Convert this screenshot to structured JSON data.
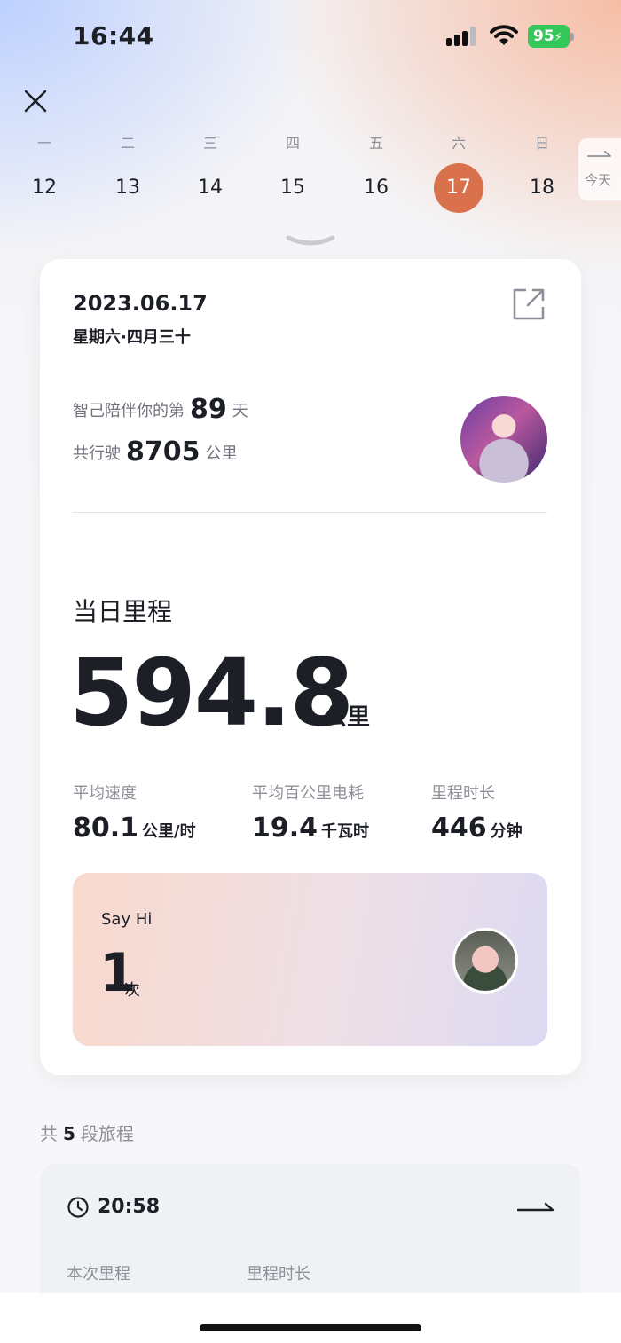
{
  "status_bar": {
    "time": "16:44",
    "battery": "95"
  },
  "calendar": {
    "days": [
      {
        "weekday": "一",
        "date": "12"
      },
      {
        "weekday": "二",
        "date": "13"
      },
      {
        "weekday": "三",
        "date": "14"
      },
      {
        "weekday": "四",
        "date": "15"
      },
      {
        "weekday": "五",
        "date": "16"
      },
      {
        "weekday": "六",
        "date": "17"
      },
      {
        "weekday": "日",
        "date": "18"
      }
    ],
    "selected": "17",
    "today_label": "今天"
  },
  "summary": {
    "date": "2023.06.17",
    "lunar": "星期六·四月三十",
    "companion_prefix": "智己陪伴你的第",
    "companion_days": "89",
    "companion_suffix": "天",
    "total_prefix": "共行驶",
    "total_km": "8705",
    "total_unit": "公里",
    "daily_title": "当日里程",
    "daily_value": "594.8",
    "daily_unit": "公里",
    "metrics": [
      {
        "label": "平均速度",
        "value": "80.1",
        "unit": "公里/时"
      },
      {
        "label": "平均百公里电耗",
        "value": "19.4",
        "unit": "千瓦时"
      },
      {
        "label": "里程时长",
        "value": "446",
        "unit": "分钟"
      }
    ],
    "sayhi": {
      "title": "Say Hi",
      "count": "1",
      "unit": "次"
    }
  },
  "trips": {
    "prefix": "共",
    "count": "5",
    "suffix": "段旅程",
    "first": {
      "time": "20:58",
      "col1": "本次里程",
      "col2": "里程时长"
    }
  },
  "colors": {
    "accent": "#d9714d",
    "battery": "#35c759"
  }
}
